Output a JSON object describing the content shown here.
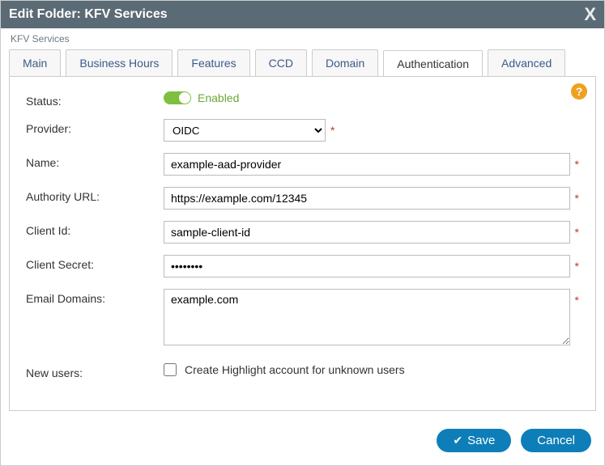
{
  "titlebar": {
    "title": "Edit Folder: KFV Services"
  },
  "breadcrumb": "KFV Services",
  "tabs": [
    {
      "label": "Main",
      "active": false
    },
    {
      "label": "Business Hours",
      "active": false
    },
    {
      "label": "Features",
      "active": false
    },
    {
      "label": "CCD",
      "active": false
    },
    {
      "label": "Domain",
      "active": false
    },
    {
      "label": "Authentication",
      "active": true
    },
    {
      "label": "Advanced",
      "active": false
    }
  ],
  "form": {
    "status": {
      "label": "Status:",
      "text": "Enabled",
      "enabled": true
    },
    "provider": {
      "label": "Provider:",
      "value": "OIDC",
      "options": [
        "OIDC"
      ],
      "required": true
    },
    "name": {
      "label": "Name:",
      "value": "example-aad-provider",
      "required": true
    },
    "authority_url": {
      "label": "Authority URL:",
      "value": "https://example.com/12345",
      "required": true
    },
    "client_id": {
      "label": "Client Id:",
      "value": "sample-client-id",
      "required": true
    },
    "client_secret": {
      "label": "Client Secret:",
      "value": "••••••••",
      "required": true
    },
    "email_domains": {
      "label": "Email Domains:",
      "value": "example.com",
      "required": true
    },
    "new_users": {
      "label": "New users:",
      "checkbox_label": "Create Highlight account for unknown users",
      "checked": false
    }
  },
  "footer": {
    "save": "Save",
    "cancel": "Cancel"
  },
  "help_icon": "?"
}
